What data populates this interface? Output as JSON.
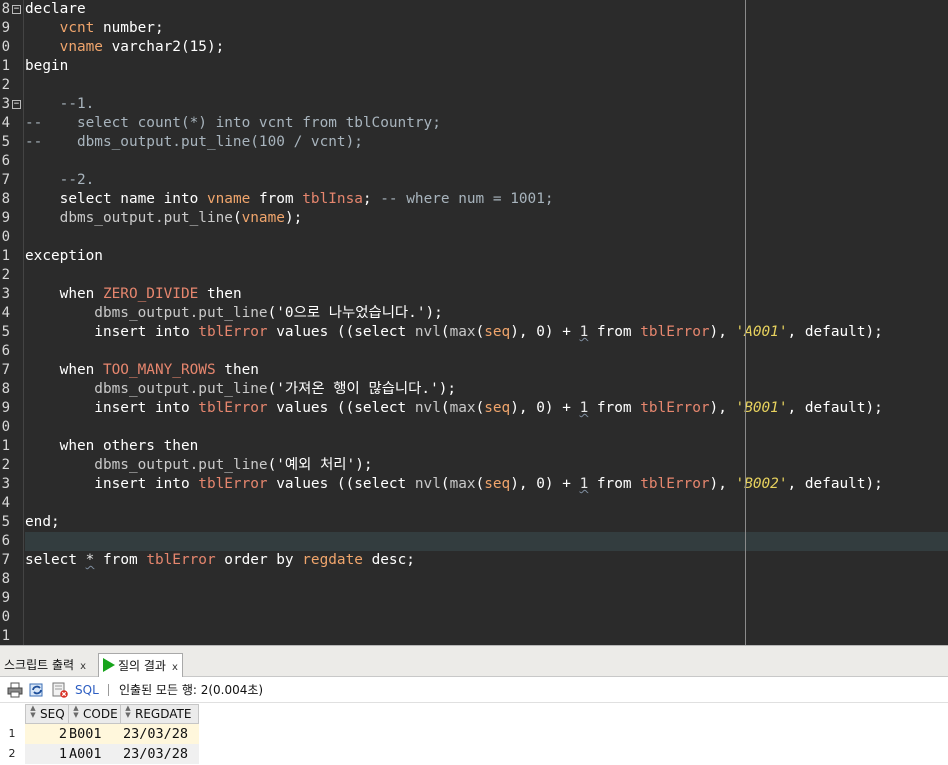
{
  "editor": {
    "gutter_numbers": [
      "8",
      "9",
      "0",
      "1",
      "2",
      "3",
      "4",
      "5",
      "6",
      "7",
      "8",
      "9",
      "0",
      "1",
      "2",
      "3",
      "4",
      "5",
      "6",
      "7",
      "8",
      "9",
      "0",
      "1",
      "2",
      "3",
      "4",
      "5",
      "6",
      "7",
      "8",
      "9",
      "0",
      "1"
    ],
    "lines": [
      [
        [
          "kw",
          "declare"
        ]
      ],
      [
        [
          "kw",
          "    "
        ],
        [
          "var",
          "vcnt"
        ],
        [
          "kw",
          " number;"
        ]
      ],
      [
        [
          "kw",
          "    "
        ],
        [
          "var",
          "vname"
        ],
        [
          "kw",
          " varchar2"
        ],
        [
          "punct",
          "("
        ],
        [
          "num",
          "15"
        ],
        [
          "punct",
          ");"
        ]
      ],
      [
        [
          "kw",
          "begin"
        ]
      ],
      [],
      [
        [
          "cmt",
          "    --1."
        ]
      ],
      [
        [
          "cmt",
          "--    select count(*) into vcnt from tblCountry;"
        ]
      ],
      [
        [
          "cmt",
          "--    dbms_output.put_line(100 / vcnt);"
        ]
      ],
      [],
      [
        [
          "cmt",
          "    --2."
        ]
      ],
      [
        [
          "kw",
          "    select name into "
        ],
        [
          "var",
          "vname"
        ],
        [
          "kw",
          " from "
        ],
        [
          "tbl",
          "tblInsa"
        ],
        [
          "kw",
          ";"
        ],
        [
          "cmt",
          " -- where num = 1001;"
        ]
      ],
      [
        [
          "fn",
          "    dbms_output.put_line"
        ],
        [
          "punct",
          "("
        ],
        [
          "var",
          "vname"
        ],
        [
          "punct",
          ");"
        ]
      ],
      [],
      [
        [
          "kw",
          "exception"
        ]
      ],
      [],
      [
        [
          "kw",
          "    when "
        ],
        [
          "exc",
          "ZERO_DIVIDE"
        ],
        [
          "kw",
          " then"
        ]
      ],
      [
        [
          "fn",
          "        dbms_output.put_line"
        ],
        [
          "punct",
          "("
        ],
        [
          "str",
          "'0으로 나누었습니다.'"
        ],
        [
          "punct",
          ");"
        ]
      ],
      [
        [
          "kw",
          "        insert into "
        ],
        [
          "tbl",
          "tblError"
        ],
        [
          "kw",
          " values ((select "
        ],
        [
          "fn",
          "nvl"
        ],
        [
          "punct",
          "("
        ],
        [
          "fn",
          "max"
        ],
        [
          "punct",
          "("
        ],
        [
          "var",
          "seq"
        ],
        [
          "punct",
          "), "
        ],
        [
          "num",
          "0"
        ],
        [
          "punct",
          ") "
        ],
        [
          "kw",
          "+ "
        ],
        [
          "sq",
          "1"
        ],
        [
          "kw",
          " from "
        ],
        [
          "tbl",
          "tblError"
        ],
        [
          "punct",
          "), "
        ],
        [
          "strit",
          "'A001'"
        ],
        [
          "punct",
          ", "
        ],
        [
          "kw",
          "default);"
        ]
      ],
      [],
      [
        [
          "kw",
          "    when "
        ],
        [
          "exc",
          "TOO_MANY_ROWS"
        ],
        [
          "kw",
          " then"
        ]
      ],
      [
        [
          "fn",
          "        dbms_output.put_line"
        ],
        [
          "punct",
          "("
        ],
        [
          "str",
          "'가져온 행이 많습니다.'"
        ],
        [
          "punct",
          ");"
        ]
      ],
      [
        [
          "kw",
          "        insert into "
        ],
        [
          "tbl",
          "tblError"
        ],
        [
          "kw",
          " values ((select "
        ],
        [
          "fn",
          "nvl"
        ],
        [
          "punct",
          "("
        ],
        [
          "fn",
          "max"
        ],
        [
          "punct",
          "("
        ],
        [
          "var",
          "seq"
        ],
        [
          "punct",
          "), "
        ],
        [
          "num",
          "0"
        ],
        [
          "punct",
          ") "
        ],
        [
          "kw",
          "+ "
        ],
        [
          "sq",
          "1"
        ],
        [
          "kw",
          " from "
        ],
        [
          "tbl",
          "tblError"
        ],
        [
          "punct",
          "), "
        ],
        [
          "strit",
          "'B001'"
        ],
        [
          "punct",
          ", "
        ],
        [
          "kw",
          "default);"
        ]
      ],
      [],
      [
        [
          "kw",
          "    when others then"
        ]
      ],
      [
        [
          "fn",
          "        dbms_output.put_line"
        ],
        [
          "punct",
          "("
        ],
        [
          "str",
          "'예외 처리'"
        ],
        [
          "punct",
          ");"
        ]
      ],
      [
        [
          "kw",
          "        insert into "
        ],
        [
          "tbl",
          "tblError"
        ],
        [
          "kw",
          " values ((select "
        ],
        [
          "fn",
          "nvl"
        ],
        [
          "punct",
          "("
        ],
        [
          "fn",
          "max"
        ],
        [
          "punct",
          "("
        ],
        [
          "var",
          "seq"
        ],
        [
          "punct",
          "), "
        ],
        [
          "num",
          "0"
        ],
        [
          "punct",
          ") "
        ],
        [
          "kw",
          "+ "
        ],
        [
          "sq",
          "1"
        ],
        [
          "kw",
          " from "
        ],
        [
          "tbl",
          "tblError"
        ],
        [
          "punct",
          "), "
        ],
        [
          "strit",
          "'B002'"
        ],
        [
          "punct",
          ", "
        ],
        [
          "kw",
          "default);"
        ]
      ],
      [],
      [
        [
          "kw",
          "end;"
        ]
      ],
      [],
      [
        [
          "kw",
          "select "
        ],
        [
          "sq",
          "*"
        ],
        [
          "kw",
          " from "
        ],
        [
          "tbl",
          "tblError"
        ],
        [
          "kw",
          " order by "
        ],
        [
          "var",
          "regdate"
        ],
        [
          "kw",
          " desc;"
        ]
      ],
      [],
      [],
      [],
      []
    ],
    "current_line_index": 28,
    "fold_marker": "−",
    "fold_lines": [
      0,
      5
    ]
  },
  "tabs": {
    "script_output": {
      "label": "스크립트 출력",
      "close": "x"
    },
    "query_result": {
      "label": "질의 결과",
      "close": "x"
    }
  },
  "toolbar": {
    "sql_label": "SQL",
    "status": "인출된 모든 행: 2(0.004초)"
  },
  "result": {
    "columns": [
      "SEQ",
      "CODE",
      "REGDATE"
    ],
    "rows": [
      {
        "num": "1",
        "seq": "2",
        "code": "B001",
        "regdate": "23/03/28"
      },
      {
        "num": "2",
        "seq": "1",
        "code": "A001",
        "regdate": "23/03/28"
      }
    ]
  },
  "colors": {
    "editor_bg": "#2b2b2b",
    "variable": "#f0a56c",
    "table_name": "#e6866e",
    "literal_italic": "#e7d25e",
    "comment": "#a8b4bd",
    "run_icon": "#17a41b",
    "link_blue": "#2d5ec2"
  }
}
